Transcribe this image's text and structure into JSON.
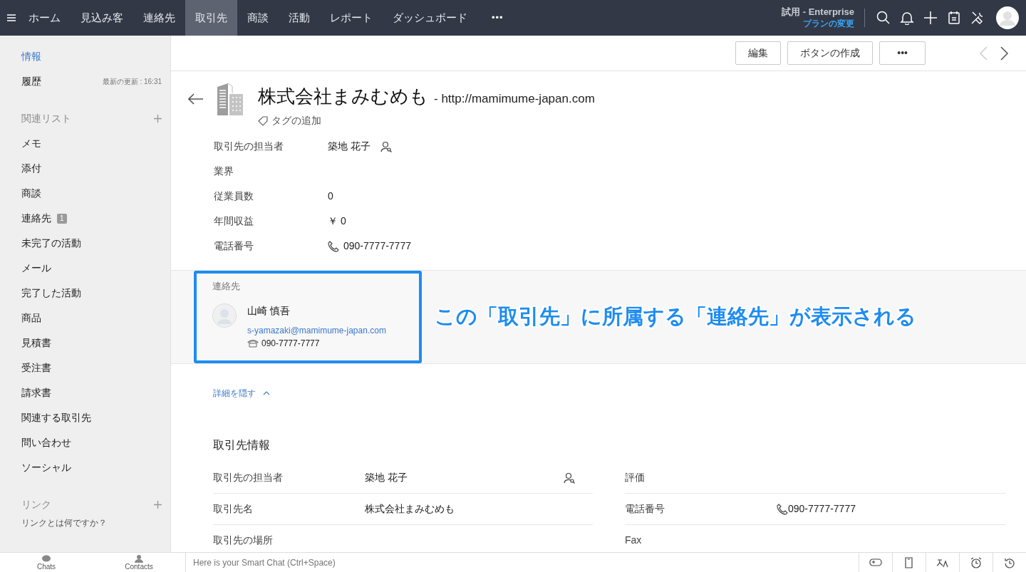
{
  "nav": {
    "tabs": [
      {
        "label": "ホーム",
        "selected": false
      },
      {
        "label": "見込み客",
        "selected": false
      },
      {
        "label": "連絡先",
        "selected": false
      },
      {
        "label": "取引先",
        "selected": true
      },
      {
        "label": "商談",
        "selected": false
      },
      {
        "label": "活動",
        "selected": false
      },
      {
        "label": "レポート",
        "selected": false
      },
      {
        "label": "ダッシュボード",
        "selected": false
      }
    ],
    "more": "•••",
    "edition": "試用 - Enterprise",
    "upgrade_link": "プランの変更"
  },
  "toolbar": {
    "buttons": [
      "編集",
      "ボタンの作成",
      "•••"
    ]
  },
  "sidebar": {
    "info": [
      {
        "label": "情報",
        "selected": true
      },
      {
        "label": "履歴",
        "selected": false,
        "meta": "最新の更新 : 16:31"
      }
    ],
    "related_heading": "関連リスト",
    "related": [
      {
        "label": "メモ"
      },
      {
        "label": "添付"
      },
      {
        "label": "商談"
      },
      {
        "label": "連絡先",
        "count": "1"
      },
      {
        "label": "未完了の活動"
      },
      {
        "label": "メール"
      },
      {
        "label": "完了した活動"
      },
      {
        "label": "商品"
      },
      {
        "label": "見積書"
      },
      {
        "label": "受注書"
      },
      {
        "label": "請求書"
      },
      {
        "label": "関連する取引先"
      },
      {
        "label": "問い合わせ"
      },
      {
        "label": "ソーシャル"
      }
    ],
    "links_heading": "リンク",
    "links_help": "リンクとは何ですか？"
  },
  "record": {
    "name": "株式会社まみむめも",
    "website": "- http://mamimume-japan.com",
    "add_tag": "タグの追加",
    "fields": [
      {
        "label": "取引先の担当者",
        "value": "築地 花子",
        "kind": "owner"
      },
      {
        "label": "業界",
        "kind": "text"
      },
      {
        "label": "従業員数",
        "value": "0",
        "kind": "text"
      },
      {
        "label": "年間収益",
        "value": "￥ 0",
        "kind": "text"
      },
      {
        "label": "電話番号",
        "value": "090-7777-7777",
        "kind": "phone"
      }
    ]
  },
  "contacts_section": {
    "heading": "連絡先",
    "contacts": [
      {
        "name": "山崎 慎吾",
        "email": "s-yamazaki@mamimume-japan.com",
        "phone": "090-7777-7777"
      }
    ],
    "annotation": "この「取引先」に所属する「連絡先」が表示される"
  },
  "details": {
    "toggle": "詳細を隠す",
    "heading": "取引先情報",
    "rows": [
      [
        {
          "label": "取引先の担当者",
          "value": "築地 花子",
          "kind": "owner"
        },
        {
          "label": "評価",
          "kind": "text"
        }
      ],
      [
        {
          "label": "取引先名",
          "value": "株式会社まみむめも",
          "kind": "text"
        },
        {
          "label": "電話番号",
          "value": "090-7777-7777",
          "kind": "phone"
        }
      ],
      [
        {
          "label": "取引先の場所",
          "kind": "text"
        },
        {
          "label": "Fax",
          "kind": "text"
        }
      ]
    ]
  },
  "bottom_bar": {
    "chats": "Chats",
    "contacts": "Contacts",
    "smart_chat_placeholder": "Here is your Smart Chat (Ctrl+Space)"
  }
}
